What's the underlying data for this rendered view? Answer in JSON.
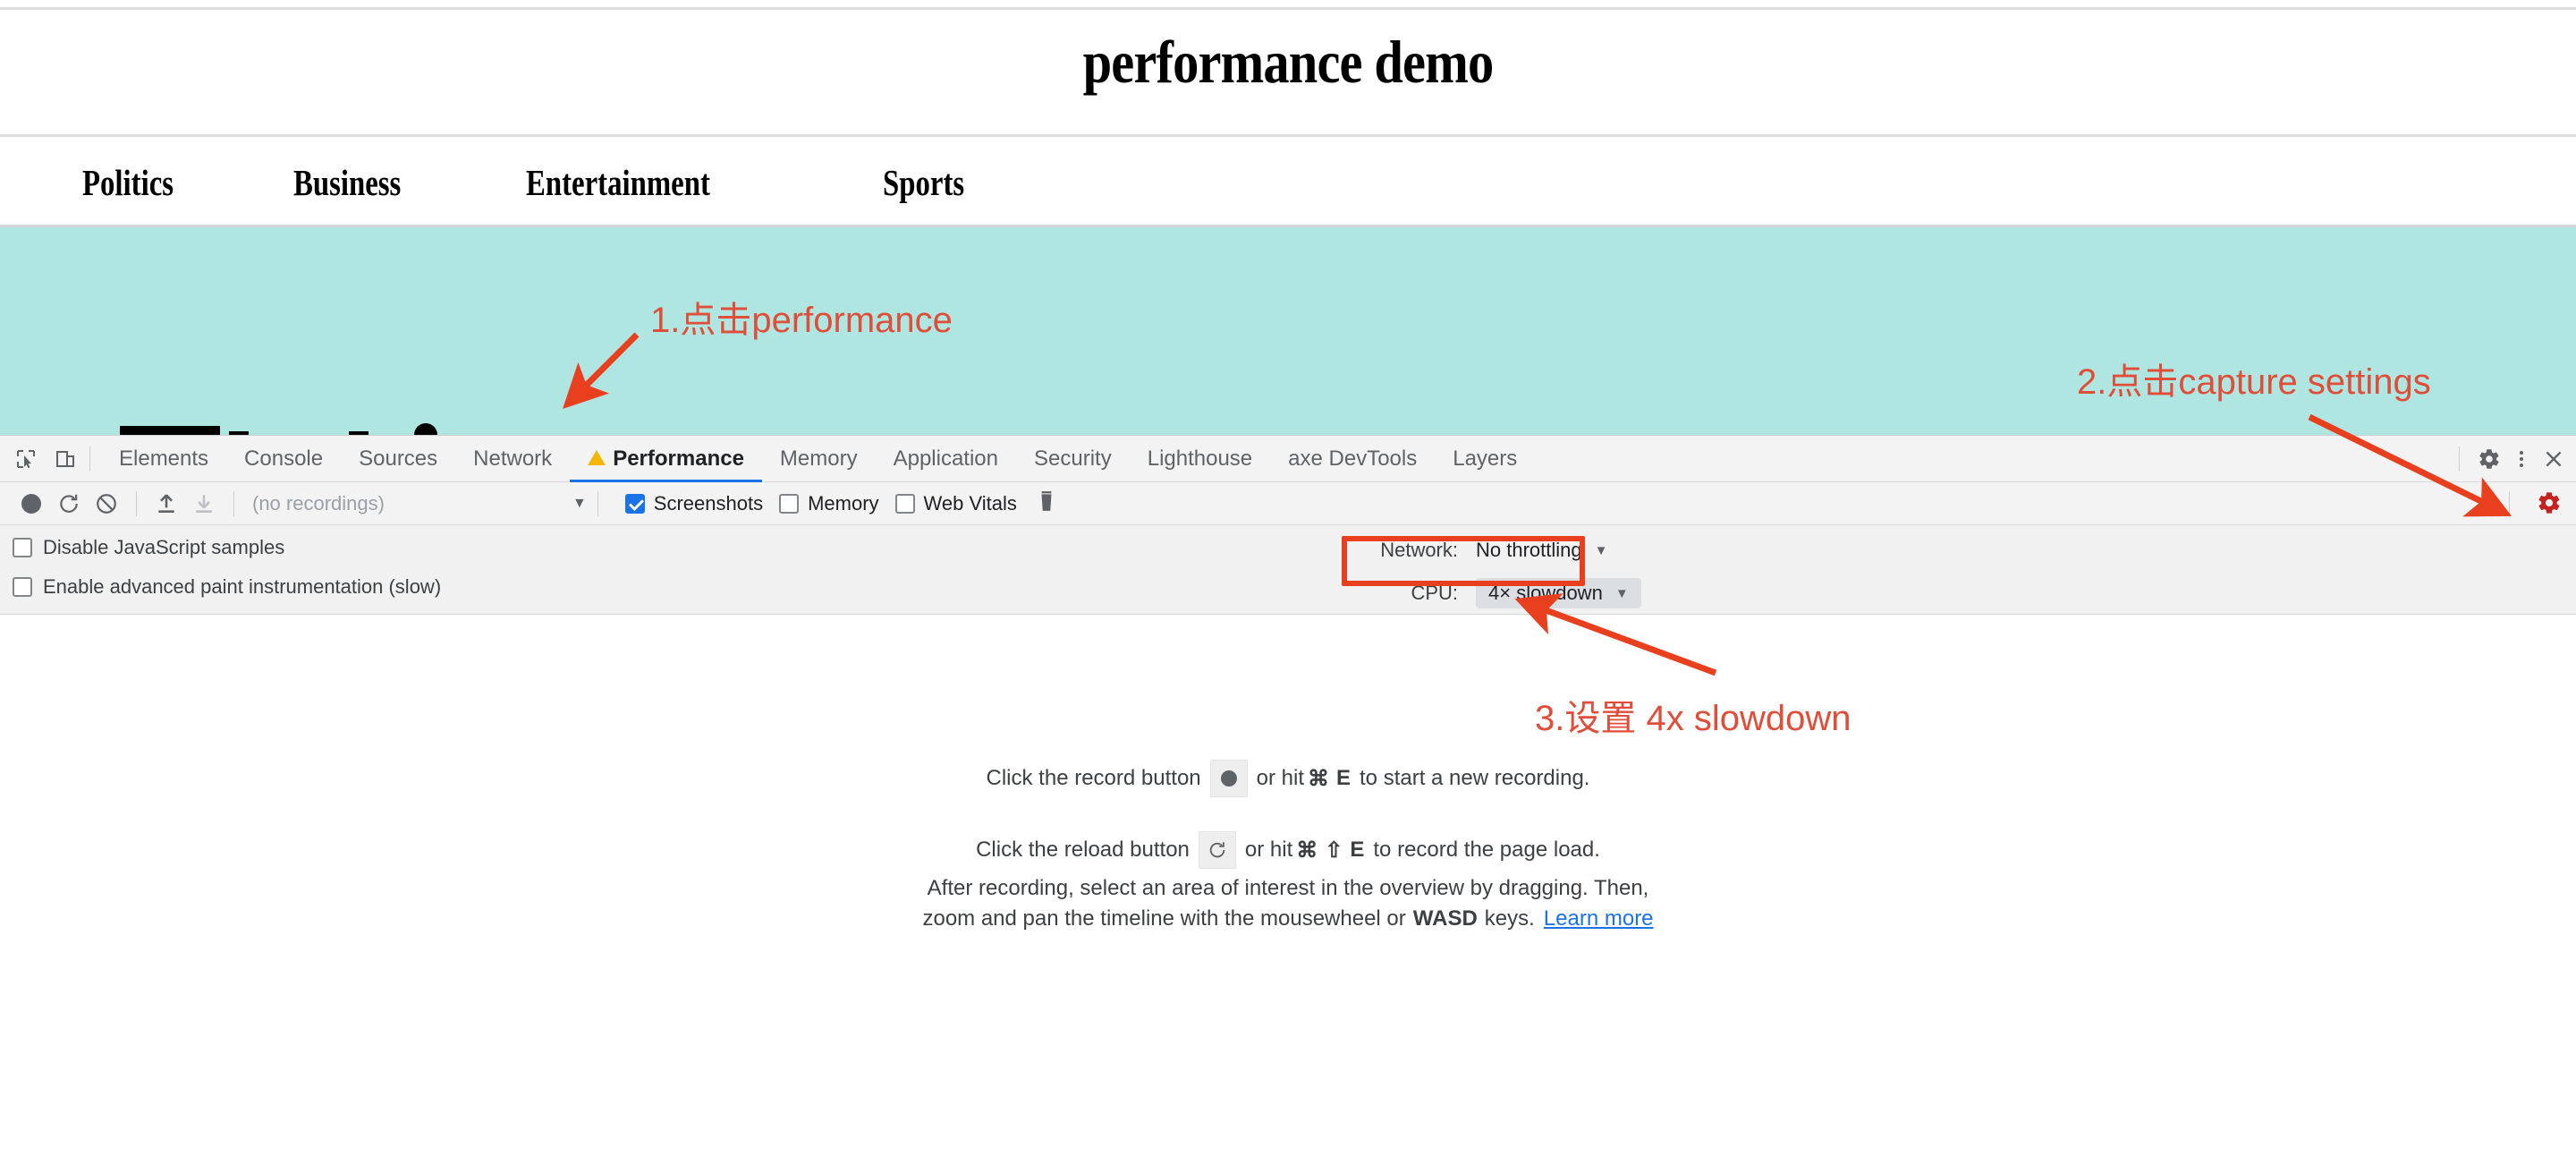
{
  "webpage": {
    "title": "performance demo",
    "nav_items": [
      {
        "label": "Politics"
      },
      {
        "label": "Business"
      },
      {
        "label": "Entertainment"
      },
      {
        "label": "Sports"
      }
    ],
    "band_color": "#AFE6E1"
  },
  "devtools": {
    "tabs": [
      {
        "label": "Elements",
        "active": false
      },
      {
        "label": "Console",
        "active": false
      },
      {
        "label": "Sources",
        "active": false
      },
      {
        "label": "Network",
        "active": false
      },
      {
        "label": "Performance",
        "active": true,
        "warning": true
      },
      {
        "label": "Memory",
        "active": false
      },
      {
        "label": "Application",
        "active": false
      },
      {
        "label": "Security",
        "active": false
      },
      {
        "label": "Lighthouse",
        "active": false
      },
      {
        "label": "axe DevTools",
        "active": false
      },
      {
        "label": "Layers",
        "active": false
      }
    ],
    "toolbar": {
      "recordings_placeholder": "(no recordings)",
      "checkboxes": [
        {
          "label": "Screenshots",
          "checked": true
        },
        {
          "label": "Memory",
          "checked": false
        },
        {
          "label": "Web Vitals",
          "checked": false
        }
      ]
    },
    "capture_settings": {
      "options": [
        {
          "label": "Disable JavaScript samples",
          "checked": false
        },
        {
          "label": "Enable advanced paint instrumentation (slow)",
          "checked": false
        }
      ],
      "network": {
        "label": "Network:",
        "value": "No throttling"
      },
      "cpu": {
        "label": "CPU:",
        "value": "4× slowdown"
      }
    },
    "instructions": {
      "line1_pre": "Click the record button",
      "line1_post_a": "or hit",
      "line1_cmd": "⌘",
      "line1_key": "E",
      "line1_post_b": "to start a new recording.",
      "line2_pre": "Click the reload button",
      "line2_post_a": "or hit",
      "line2_cmd": "⌘",
      "line2_shift": "⇧",
      "line2_key": "E",
      "line2_post_b": "to record the page load.",
      "line3_a": "After recording, select an area of interest in the overview by dragging. Then,",
      "line3_b": "zoom and pan the timeline with the mousewheel or",
      "line3_bold": "WASD",
      "line3_c": "keys.",
      "learn_more": "Learn more"
    }
  },
  "annotations": {
    "color": "#E04E39",
    "box_color": "#E8401F",
    "items": [
      {
        "text": "1.点击performance"
      },
      {
        "text": "2.点击capture settings"
      },
      {
        "text": "3.设置 4x slowdown"
      }
    ]
  }
}
